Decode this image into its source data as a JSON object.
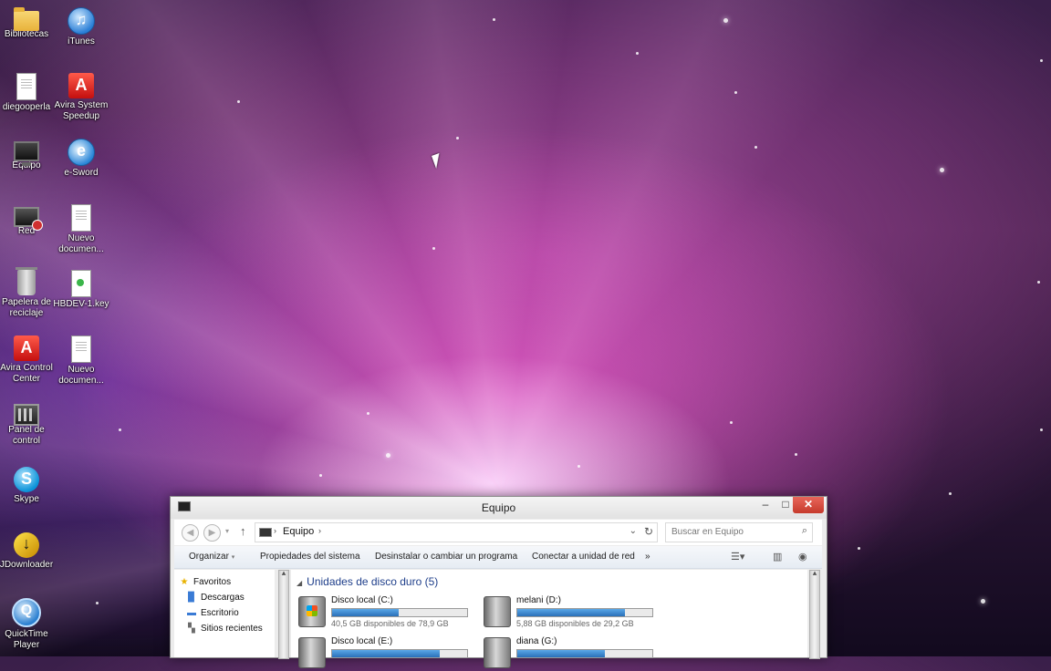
{
  "desktop": {
    "icons": [
      {
        "label": "Bibliotecas",
        "icon": "folder-icon"
      },
      {
        "label": "iTunes",
        "icon": "itunes-icon"
      },
      {
        "label": "diegooperla",
        "icon": "user-folder-icon"
      },
      {
        "label": "Avira System Speedup",
        "icon": "avira-icon"
      },
      {
        "label": "Equipo",
        "icon": "computer-icon"
      },
      {
        "label": "e-Sword",
        "icon": "esword-icon"
      },
      {
        "label": "Red",
        "icon": "network-icon"
      },
      {
        "label": "Nuevo documen...",
        "icon": "document-icon"
      },
      {
        "label": "Papelera de reciclaje",
        "icon": "recycle-bin-icon"
      },
      {
        "label": "HBDEV-1.key",
        "icon": "key-file-icon"
      },
      {
        "label": "Avira Control Center",
        "icon": "avira-icon"
      },
      {
        "label": "Nuevo documen...",
        "icon": "document-icon"
      },
      {
        "label": "Panel de control",
        "icon": "control-panel-icon"
      },
      {
        "label": "Skype",
        "icon": "skype-icon"
      },
      {
        "label": "JDownloader",
        "icon": "jdownloader-icon"
      },
      {
        "label": "QuickTime Player",
        "icon": "quicktime-icon"
      }
    ]
  },
  "window": {
    "title": "Equipo",
    "buttons": {
      "minimize": "–",
      "maximize": "□",
      "close": "✕"
    },
    "address": {
      "crumb": "Equipo",
      "separator": "›"
    },
    "search": {
      "placeholder": "Buscar en Equipo"
    },
    "commands": [
      "Organizar",
      "Propiedades del sistema",
      "Desinstalar o cambiar un programa",
      "Conectar a unidad de red",
      "»"
    ],
    "nav_pane": {
      "items": [
        "Favoritos",
        "Descargas",
        "Escritorio",
        "Sitios recientes"
      ]
    },
    "group": {
      "title": "Unidades de disco duro (5)"
    },
    "drives": [
      {
        "name": "Disco local (C:)",
        "info": "40,5 GB disponibles de 78,9 GB",
        "used_fraction": 0.49
      },
      {
        "name": "melani (D:)",
        "info": "5,88 GB disponibles de 29,2 GB",
        "used_fraction": 0.8
      },
      {
        "name": "Disco local (E:)",
        "info": "",
        "used_fraction": 0.8
      },
      {
        "name": "diana (G:)",
        "info": "",
        "used_fraction": 0.65
      }
    ]
  },
  "colors": {
    "accent": "#1e3e8a",
    "close_button": "#c63a2c",
    "drive_bar": "#2a6fb8"
  }
}
